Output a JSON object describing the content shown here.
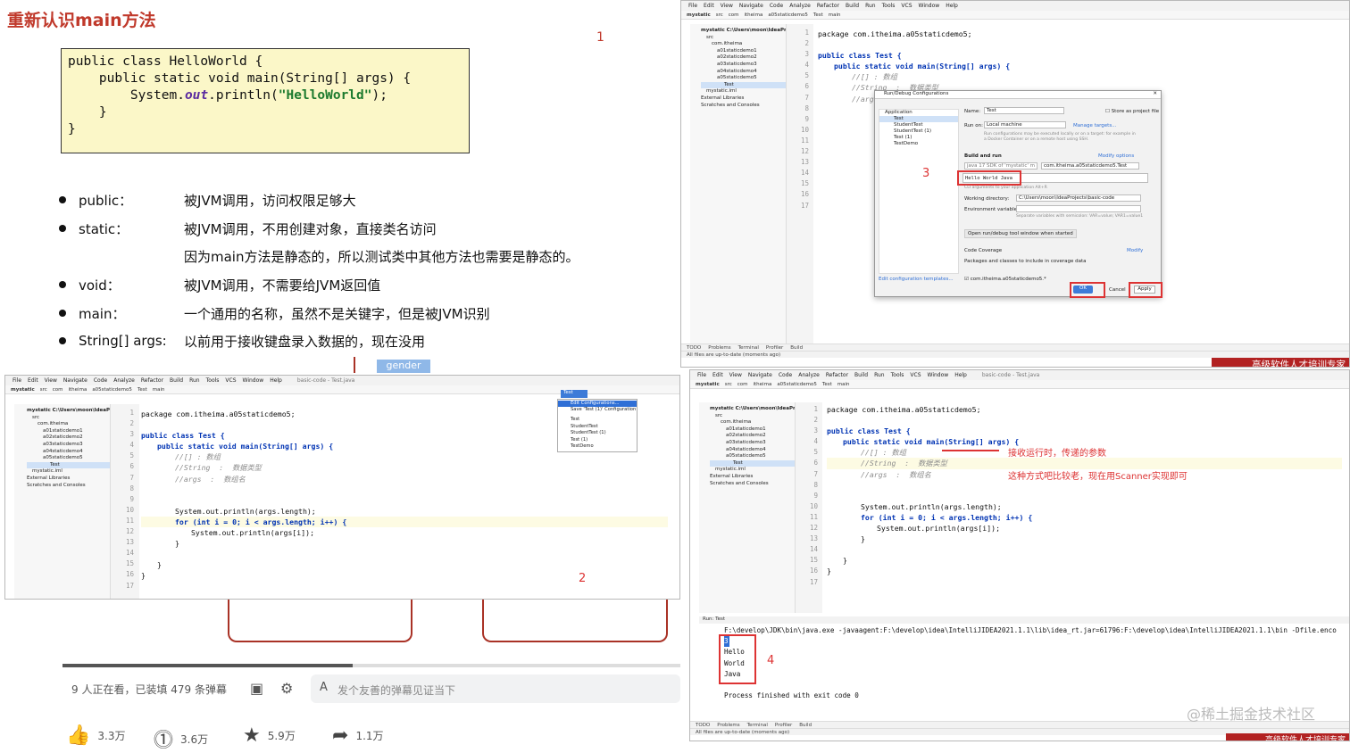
{
  "slide": {
    "title": "重新认识main方法",
    "number": "1",
    "code_lines": [
      {
        "text_before": "public class HelloWorld {",
        "italic": "",
        "string": "",
        "text_after": ""
      },
      {
        "text_before": "    public static void main(String[] args) {",
        "italic": "",
        "string": "",
        "text_after": ""
      },
      {
        "text_before": "        System.",
        "italic": "out",
        "string": "\"HelloWorld\"",
        "text_after": ");",
        "mid": ".println("
      },
      {
        "text_before": "    }",
        "italic": "",
        "string": "",
        "text_after": ""
      },
      {
        "text_before": "}",
        "italic": "",
        "string": "",
        "text_after": ""
      }
    ],
    "bullets": [
      {
        "key": "public：",
        "desc": "被JVM调用，访问权限足够大"
      },
      {
        "key": "static：",
        "desc": "被JVM调用，不用创建对象，直接类名访问"
      },
      {
        "key": "",
        "desc": "因为main方法是静态的，所以测试类中其他方法也需要是静态的。"
      },
      {
        "key": "void：",
        "desc": "被JVM调用，不需要给JVM返回值"
      },
      {
        "key": "main：",
        "desc": "一个通用的名称，虽然不是关键字，但是被JVM识别"
      },
      {
        "key": "String[] args:",
        "desc": "以前用于接收键盘录入数据的，现在没用"
      }
    ],
    "gender_label": "gender"
  },
  "video": {
    "viewers": "9 人正在看，已装填 479 条弹幕",
    "danmaku_placeholder": "发个友善的弹幕见证当下",
    "progress": 0.47,
    "stats": [
      {
        "icon": "like-icon",
        "label": "3.3万"
      },
      {
        "icon": "coin-icon",
        "label": "3.6万"
      },
      {
        "icon": "star-icon",
        "label": "5.9万"
      },
      {
        "icon": "share-icon",
        "label": "1.1万"
      }
    ]
  },
  "ide_menu": [
    "File",
    "Edit",
    "View",
    "Navigate",
    "Code",
    "Analyze",
    "Refactor",
    "Build",
    "Run",
    "Tools",
    "VCS",
    "Window",
    "Help"
  ],
  "ide_nav": [
    "mystatic",
    "src",
    "com",
    "itheima",
    "a05staticdemo5",
    "Test",
    "main"
  ],
  "tree_items": [
    "mystatic C:\\Users\\moon\\IdeaProjects\\",
    "src",
    "com.itheima",
    "a01staticdemo1",
    "a02staticdemo2",
    "a03staticdemo3",
    "a04staticdemo4",
    "a05staticdemo5",
    "Test",
    "mystatic.iml",
    "External Libraries",
    "Scratches and Consoles"
  ],
  "code": {
    "package": "package com.itheima.a05staticdemo5;",
    "class_decl": "public class Test {",
    "main_decl": "public static void main(String[] args) {",
    "c1": "//[] : 数组",
    "c2": "//String  :  数据类型",
    "c3": "//args  :  数组名",
    "p1": "System.out.println(args.length);",
    "for_loop": "for (int i = 0; i < args.length; i++) {",
    "p2": "System.out.println(args[i]);",
    "close1": "}",
    "close2": "}",
    "close3": "}"
  },
  "ide_tr": {
    "annotation": "3",
    "dialog": {
      "title": "Run/Debug Configurations",
      "name_label": "Name:",
      "name_value": "Test",
      "store_label": "Store as project file",
      "run_on_label": "Run on:",
      "run_on_value": "Local machine",
      "manage_targets": "Manage targets...",
      "run_on_help": "Run configurations may be executed locally or on a target: for example in a Docker Container or on a remote host using SSH.",
      "build_run": "Build and run",
      "modify_options": "Modify options",
      "java_version": "java 17 SDK of 'mystatic' m",
      "main_class": "com.itheima.a05staticdemo5.Test",
      "program_args": "Hello World Java",
      "program_args_hint": "CLI arguments to your application  Alt+R",
      "working_dir_label": "Working directory:",
      "working_dir_value": "C:\\Users\\moon\\IdeaProjects\\basic-code",
      "env_label": "Environment variables:",
      "env_hint": "Separate variables with semicolon: VAR=value; VAR1=value1",
      "open_tool": "Open run/debug tool window when started",
      "code_coverage": "Code Coverage",
      "modify": "Modify",
      "coverage_pkgs": "Packages and classes to include in coverage data",
      "coverage_item": "com.itheima.a05staticdemo5.*",
      "edit_templates": "Edit configuration templates...",
      "ok": "OK",
      "cancel": "Cancel",
      "apply": "Apply",
      "tree": [
        "Application",
        "Test",
        "StudentTest",
        "StudentTest (1)",
        "Test (1)",
        "TestDemo"
      ]
    },
    "status": "All files are up-to-date (moments ago)",
    "banner": "高级软件人才培训专家"
  },
  "ide_bl": {
    "annotation": "2",
    "title": "basic-code - Test.java",
    "dropdown_items": [
      "Edit Configurations...",
      "Save 'Test (1)' Configuration",
      "Test",
      "StudentTest",
      "StudentTest (1)",
      "Test (1)",
      "TestDemo"
    ]
  },
  "ide_br": {
    "annotation_args": "接收运行时，传递的参数",
    "annotation_old": "这种方式吧比较老，现在用Scanner实现即可",
    "title": "basic-code - Test.java",
    "run_tab": "Test",
    "run_cmd": "F:\\develop\\JDK\\bin\\java.exe -javaagent:F:\\develop\\idea\\IntelliJIDEA2021.1.1\\lib\\idea_rt.jar=61796:F:\\develop\\idea\\IntelliJIDEA2021.1.1\\bin -Dfile.enco",
    "output": [
      "3",
      "Hello",
      "World",
      "Java"
    ],
    "annotation": "4",
    "finished": "Process finished with exit code 0",
    "status": "All files are up-to-date (moments ago)",
    "watermark": "@稀土掘金技术社区",
    "banner": "高级软件人才培训专家"
  },
  "tool_tabs": [
    "TODO",
    "Problems",
    "Terminal",
    "Profiler",
    "Build"
  ]
}
